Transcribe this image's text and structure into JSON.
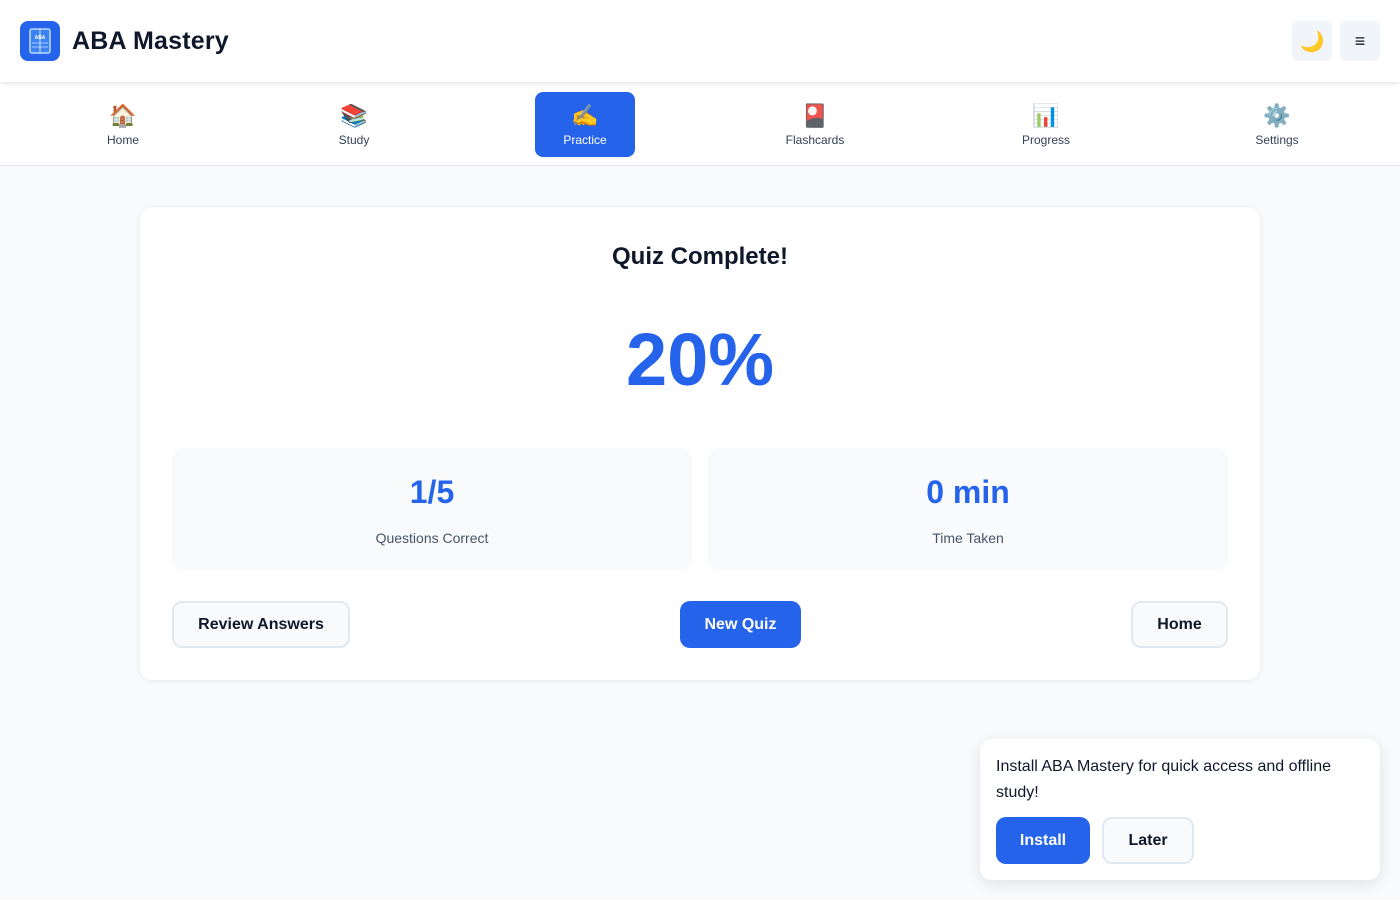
{
  "header": {
    "app_title": "ABA Mastery",
    "logo_text": "ABA",
    "theme_toggle_icon": "🌙",
    "menu_icon": "≡"
  },
  "nav": {
    "items": [
      {
        "icon": "🏠",
        "label": "Home"
      },
      {
        "icon": "📚",
        "label": "Study"
      },
      {
        "icon": "✍️",
        "label": "Practice",
        "active": true
      },
      {
        "icon": "🎴",
        "label": "Flashcards"
      },
      {
        "icon": "📊",
        "label": "Progress"
      },
      {
        "icon": "⚙️",
        "label": "Settings"
      }
    ]
  },
  "results": {
    "title": "Quiz Complete!",
    "score": "20%",
    "stats": [
      {
        "value": "1/5",
        "label": "Questions Correct"
      },
      {
        "value": "0 min",
        "label": "Time Taken"
      }
    ],
    "buttons": {
      "review": "Review Answers",
      "new_quiz": "New Quiz",
      "home": "Home"
    }
  },
  "install_prompt": {
    "message": "Install ABA Mastery for quick access and offline study!",
    "install_label": "Install",
    "later_label": "Later"
  },
  "colors": {
    "accent": "#2563eb",
    "background": "#f8fafc",
    "text": "#0f172a"
  }
}
